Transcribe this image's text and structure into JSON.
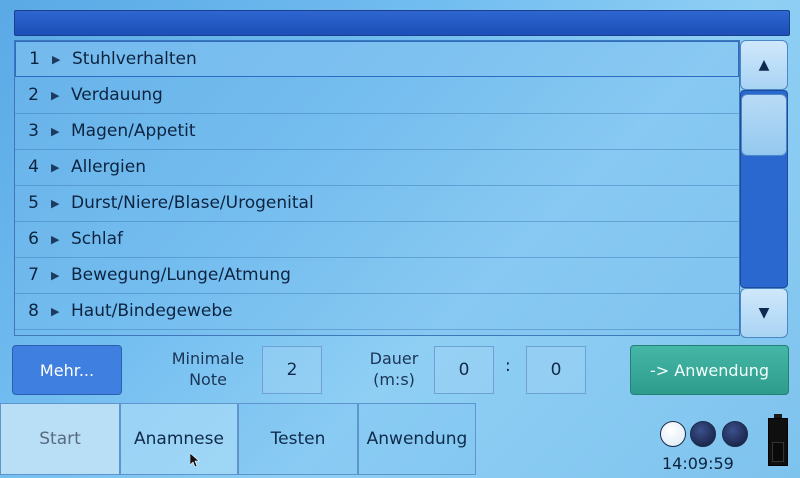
{
  "list": {
    "items": [
      {
        "number": "1",
        "label": "Stuhlverhalten"
      },
      {
        "number": "2",
        "label": "Verdauung"
      },
      {
        "number": "3",
        "label": "Magen/Appetit"
      },
      {
        "number": "4",
        "label": "Allergien"
      },
      {
        "number": "5",
        "label": "Durst/Niere/Blase/Urogenital"
      },
      {
        "number": "6",
        "label": "Schlaf"
      },
      {
        "number": "7",
        "label": "Bewegung/Lunge/Atmung"
      },
      {
        "number": "8",
        "label": "Haut/Bindegewebe"
      }
    ],
    "selected_index": 0
  },
  "scrollbar": {
    "up_icon": "triangle-up-icon",
    "down_icon": "triangle-down-icon"
  },
  "controls": {
    "mehr_label": "Mehr...",
    "min_note_label_line1": "Minimale",
    "min_note_label_line2": "Note",
    "min_note_value": "2",
    "duration_label_line1": "Dauer",
    "duration_label_line2": "(m:s)",
    "duration_minutes": "0",
    "duration_separator": ":",
    "duration_seconds": "0",
    "apply_button_label": "-> Anwendung"
  },
  "tabs": [
    {
      "label": "Start"
    },
    {
      "label": "Anamnese"
    },
    {
      "label": "Testen"
    },
    {
      "label": "Anwendung"
    }
  ],
  "status": {
    "indicators": [
      "empty",
      "full",
      "full"
    ],
    "time": "14:09:59",
    "battery_icon": "battery-icon"
  },
  "colors": {
    "header_bar": "#1c4fb8",
    "mehr_button": "#3f7fe0",
    "apply_button": "#2e9c8d",
    "scroll_track": "#2a67cf"
  }
}
